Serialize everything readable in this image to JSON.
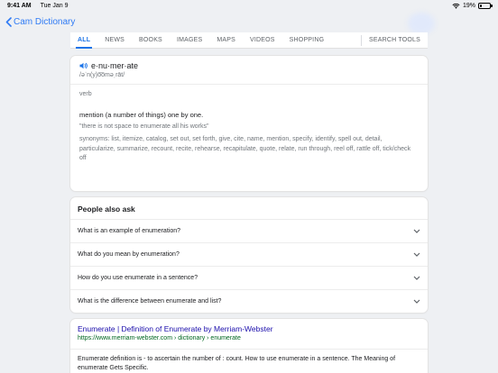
{
  "status": {
    "time": "9:41 AM",
    "date": "Tue Jan 9",
    "battery": "19%",
    "battery_level": 0.19
  },
  "nav": {
    "back_label": "Cam Dictionary"
  },
  "tabs": [
    {
      "label": "ALL",
      "active": true
    },
    {
      "label": "NEWS"
    },
    {
      "label": "BOOKS"
    },
    {
      "label": "IMAGES"
    },
    {
      "label": "MAPS"
    },
    {
      "label": "VIDEOS"
    },
    {
      "label": "SHOPPING"
    },
    {
      "label": "SEARCH TOOLS"
    }
  ],
  "dictionary": {
    "word": "e·nu·mer·ate",
    "phonetic": "/əˈn(y)o͞oməˌrāt/",
    "part_of_speech": "verb",
    "definition": "mention (a number of things) one by one.",
    "example": "\"there is not space to enumerate all his works\"",
    "synonyms": "synonyms: list, itemize, catalog, set out, set forth, give, cite, name, mention, specify, identify, spell out, detail, particularize, summarize, recount, recite, rehearse, recapitulate, quote, relate, run through, reel off, rattle off, tick/check off"
  },
  "paa": {
    "title": "People also ask",
    "questions": [
      "What is an example of enumeration?",
      "What do you mean by enumeration?",
      "How do you use enumerate in a sentence?",
      "What is the difference between enumerate and list?"
    ]
  },
  "result": {
    "title": "Enumerate | Definition of Enumerate by Merriam-Webster",
    "url": "https://www.merriam-webster.com › dictionary › enumerate",
    "snippet": "Enumerate definition is - to ascertain the number of : count. How to use enumerate in a sentence. The Meaning of enumerate Gets Specific."
  },
  "colors": {
    "accent": "#1a73e8",
    "ios_blue": "#2f7bf5",
    "link": "#1a0dab",
    "url": "#006621"
  }
}
